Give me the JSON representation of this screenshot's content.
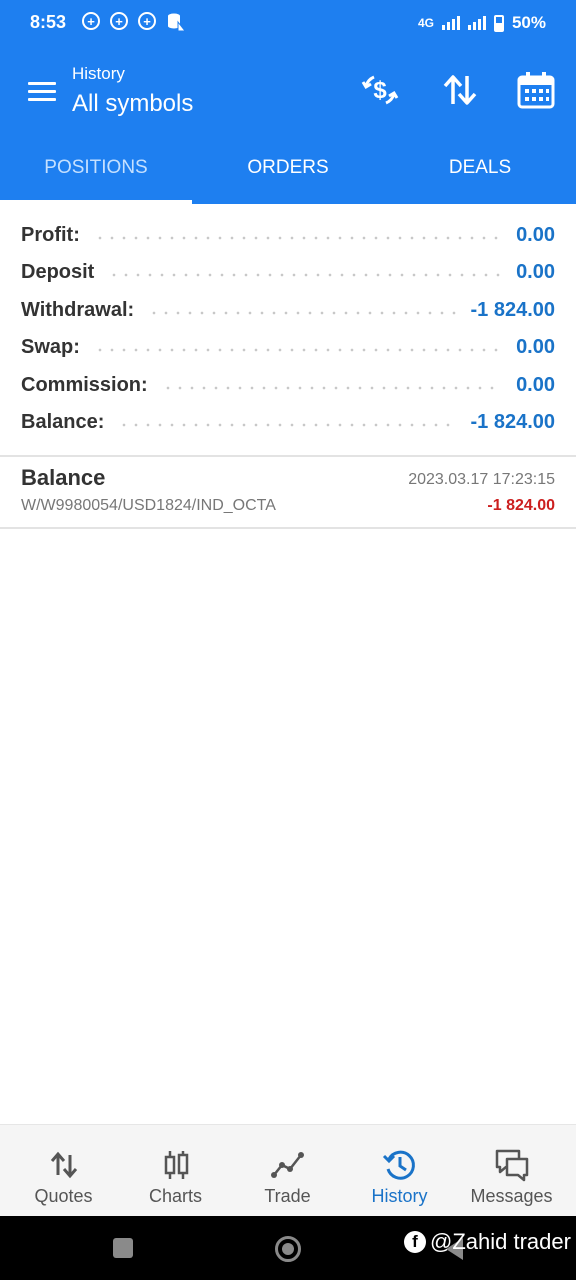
{
  "status_bar": {
    "time": "8:53",
    "notification_icons": [
      "+",
      "+",
      "+"
    ],
    "network": "4G",
    "battery": "50%"
  },
  "app_bar": {
    "subtitle": "History",
    "title": "All symbols",
    "tools": [
      "currency-exchange-icon",
      "sort-icon",
      "calendar-icon"
    ]
  },
  "tabs": [
    {
      "label": "POSITIONS",
      "active": true
    },
    {
      "label": "ORDERS",
      "active": false
    },
    {
      "label": "DEALS",
      "active": false
    }
  ],
  "summary": [
    {
      "label": "Profit:",
      "value": "0.00"
    },
    {
      "label": "Deposit",
      "value": "0.00"
    },
    {
      "label": "Withdrawal:",
      "value": "-1 824.00"
    },
    {
      "label": "Swap:",
      "value": "0.00"
    },
    {
      "label": "Commission:",
      "value": "0.00"
    },
    {
      "label": "Balance:",
      "value": "-1 824.00"
    }
  ],
  "deal": {
    "title": "Balance",
    "time": "2023.03.17 17:23:15",
    "comment": "W/W9980054/USD1824/IND_OCTA",
    "amount": "-1 824.00"
  },
  "bottom_nav": [
    {
      "label": "Quotes",
      "icon": "quotes-icon",
      "active": false
    },
    {
      "label": "Charts",
      "icon": "charts-icon",
      "active": false
    },
    {
      "label": "Trade",
      "icon": "trade-icon",
      "active": false
    },
    {
      "label": "History",
      "icon": "history-icon",
      "active": true
    },
    {
      "label": "Messages",
      "icon": "messages-icon",
      "active": false
    }
  ],
  "watermark": {
    "text": "@Zahid trader",
    "icon_letter": "f"
  },
  "colors": {
    "primary": "#1e7ff0",
    "value_blue": "#1a73c8",
    "negative_red": "#cc1f1f"
  }
}
